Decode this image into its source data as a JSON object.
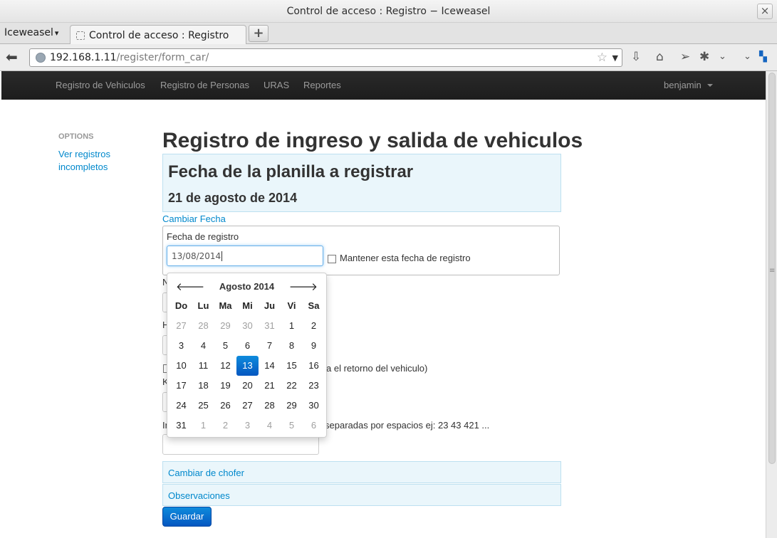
{
  "window": {
    "title": "Control de acceso : Registro − Iceweasel"
  },
  "browser": {
    "app_menu": "Iceweasel",
    "tab_title": "Control de acceso : Registro",
    "url_host": "192.168.1.11",
    "url_path": "/register/form_car/"
  },
  "site_nav": {
    "items": [
      "Registro de Vehiculos",
      "Registro de Personas",
      "URAS",
      "Reportes"
    ],
    "user": "benjamin"
  },
  "sidebar": {
    "heading": "OPTIONS",
    "link": "Ver registros incompletos"
  },
  "main": {
    "title": "Registro de ingreso y salida de vehiculos",
    "date_panel": {
      "heading": "Fecha de la planilla a registrar",
      "date": "21 de agosto de 2014"
    },
    "change_date": "Cambiar Fecha",
    "fecha_label": "Fecha de registro",
    "fecha_value": "13/08/2014",
    "keep_label": "Mantener esta fecha de registro",
    "frag_n": "N",
    "frag_h": "H",
    "frag_return": "a el retorno del vehiculo)",
    "frag_k": "K",
    "frag_i": "In",
    "frag_sep": "separadas por espacios ej: 23 43 421 ...",
    "accordion": [
      "Cambiar de chofer",
      "Observaciones"
    ],
    "save": "Guardar"
  },
  "datepicker": {
    "month": "Agosto 2014",
    "days_of_week": [
      "Do",
      "Lu",
      "Ma",
      "Mi",
      "Ju",
      "Vi",
      "Sa"
    ],
    "weeks": [
      [
        "27",
        "28",
        "29",
        "30",
        "31",
        "1",
        "2"
      ],
      [
        "3",
        "4",
        "5",
        "6",
        "7",
        "8",
        "9"
      ],
      [
        "10",
        "11",
        "12",
        "13",
        "14",
        "15",
        "16"
      ],
      [
        "17",
        "18",
        "19",
        "20",
        "21",
        "22",
        "23"
      ],
      [
        "24",
        "25",
        "26",
        "27",
        "28",
        "29",
        "30"
      ],
      [
        "31",
        "1",
        "2",
        "3",
        "4",
        "5",
        "6"
      ]
    ],
    "selected": "13"
  }
}
